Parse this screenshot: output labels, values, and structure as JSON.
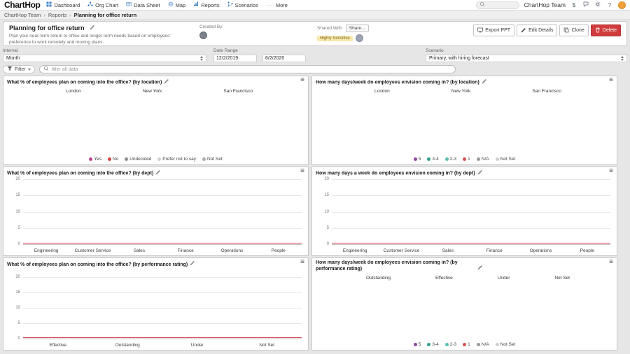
{
  "glyphs": {
    "menu": "≡",
    "more": "···",
    "dollar": "$",
    "help": "?"
  },
  "topnav": {
    "logo": "ChartHop",
    "items": [
      "Dashboard",
      "Org Chart",
      "Data Sheet",
      "Map",
      "Reports",
      "Scenarios",
      "More"
    ],
    "team_name": "ChartHop Team"
  },
  "breadcrumb": [
    "ChartHop Team",
    "Reports",
    "Planning for office return"
  ],
  "report": {
    "title": "Planning for office return",
    "description": "Plan your near-term return to office and longer term needs based on employees' preference to work remotely and moving plans.",
    "created_by_label": "Created By",
    "shared_with_label": "Shared With",
    "share_button": "Share...",
    "sensitivity_badge": "Highly Sensitive",
    "actions": {
      "export": "Export PPT",
      "edit": "Edit Details",
      "clone": "Clone",
      "delete": "Delete"
    }
  },
  "controls": {
    "interval_label": "Interval",
    "interval_value": "Month",
    "date_range_label": "Date Range",
    "date_start": "12/2/2019",
    "date_end": "6/2/2020",
    "scenario_label": "Scenario",
    "scenario_value": "Primary, with hiring forecast",
    "filter_button": "Filter",
    "search_placeholder": "filter all data"
  },
  "chart_data": [
    {
      "type": "column",
      "title": "What % of employees plan on coming into the office? (by location)",
      "categories": [
        "London",
        "New York",
        "San Francisco"
      ],
      "legend": [
        {
          "label": "Yes",
          "color": "#c2418f"
        },
        {
          "label": "No",
          "color": "#d64545"
        },
        {
          "label": "Undecided",
          "color": "#8d8d8d"
        },
        {
          "label": "Prefer not to say",
          "color": "#d0d0d0"
        },
        {
          "label": "Not Set",
          "color": "#ababab"
        }
      ],
      "series": []
    },
    {
      "type": "column",
      "title": "How many days/week do employees envision coming in? (by location)",
      "categories": [
        "London",
        "New York",
        "San Francisco"
      ],
      "legend": [
        {
          "label": "5",
          "color": "#9146a1"
        },
        {
          "label": "3-4",
          "color": "#2fa08c"
        },
        {
          "label": "2-3",
          "color": "#5cc0b4"
        },
        {
          "label": "1",
          "color": "#d65050"
        },
        {
          "label": "N/A",
          "color": "#9a9a9a"
        },
        {
          "label": "Not Set",
          "color": "#cfcfcf"
        }
      ],
      "series": []
    },
    {
      "type": "area",
      "title": "What % of employees plan on coming into the office? (by dept)",
      "categories": [
        "Engineering",
        "Customer Service",
        "Sales",
        "Finance",
        "Operations",
        "People"
      ],
      "ylim": [
        0,
        20
      ],
      "yticks": [
        0,
        5,
        10,
        15,
        20
      ],
      "series": [
        {
          "name": "",
          "color": "#d9505e",
          "values": [
            0.4,
            0.4,
            0.4,
            0.4,
            0.4,
            0.4
          ]
        }
      ]
    },
    {
      "type": "area",
      "title": "How many days a week do employees envision coming in? (by dept)",
      "categories": [
        "Engineering",
        "Customer Service",
        "Sales",
        "Finance",
        "Operations",
        "People"
      ],
      "ylim": [
        0,
        20
      ],
      "yticks": [
        0,
        5,
        10,
        15,
        20
      ],
      "series": [
        {
          "name": "",
          "color": "#d9505e",
          "values": [
            0.4,
            0.4,
            0.4,
            0.4,
            0.4,
            0.4
          ]
        }
      ]
    },
    {
      "type": "area",
      "title": "What % of employees plan on coming into the office? (by performance rating)",
      "categories": [
        "Effective",
        "Outstanding",
        "Under",
        "Not Set"
      ],
      "ylim": [
        0,
        20
      ],
      "yticks": [
        0,
        5,
        10,
        15,
        20
      ],
      "series": [
        {
          "name": "",
          "color": "#d9505e",
          "values": [
            0.4,
            0.4,
            0.4,
            0.4
          ]
        }
      ]
    },
    {
      "type": "column",
      "title": "How many days/week do employees envision coming in? (by performance rating)",
      "categories": [
        "Outstanding",
        "Effective",
        "Under",
        "Not Set"
      ],
      "legend": [
        {
          "label": "5",
          "color": "#9146a1"
        },
        {
          "label": "3-4",
          "color": "#2fa08c"
        },
        {
          "label": "2-3",
          "color": "#5cc0b4"
        },
        {
          "label": "1",
          "color": "#d65050"
        },
        {
          "label": "N/A",
          "color": "#9a9a9a"
        },
        {
          "label": "Not Set",
          "color": "#cfcfcf"
        }
      ],
      "series": []
    }
  ]
}
